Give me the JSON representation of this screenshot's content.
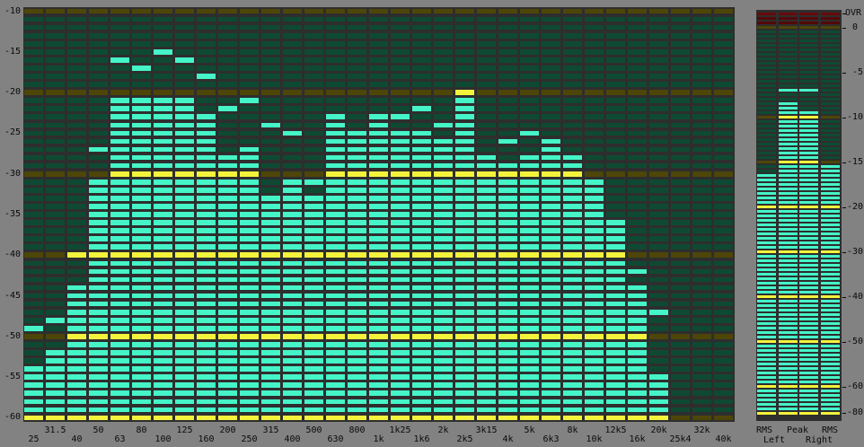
{
  "colors": {
    "lit": "#45f5c8",
    "dark": "#0e4a33",
    "marker_lit": "#f3f33c",
    "marker_dark": "#4d4608",
    "over_lit": "#6a0909",
    "panel": "#2e2e2e",
    "background": "#828282"
  },
  "rta": {
    "y_axis_labels": [
      "-10",
      "-15",
      "-20",
      "-25",
      "-30",
      "-35",
      "-40",
      "-45",
      "-50",
      "-55",
      "-60"
    ],
    "y_axis_values": [
      -10,
      -15,
      -20,
      -25,
      -30,
      -35,
      -40,
      -45,
      -50,
      -55,
      -60
    ],
    "y_range_db": [
      -60.5,
      -9.5
    ],
    "marker_levels_db": [
      -60,
      -50,
      -40,
      -30,
      -20,
      -10
    ],
    "bands": [
      {
        "label": "25",
        "level": -54,
        "peak": -49
      },
      {
        "label": "31.5",
        "level": -52,
        "peak": -48
      },
      {
        "label": "40",
        "level": -44,
        "peak": -40
      },
      {
        "label": "50",
        "level": -31,
        "peak": -27
      },
      {
        "label": "63",
        "level": -21,
        "peak": -16
      },
      {
        "label": "80",
        "level": -21,
        "peak": -17
      },
      {
        "label": "100",
        "level": -21,
        "peak": -15
      },
      {
        "label": "125",
        "level": -21,
        "peak": -16
      },
      {
        "label": "160",
        "level": -23,
        "peak": -18
      },
      {
        "label": "200",
        "level": -28,
        "peak": -22
      },
      {
        "label": "250",
        "level": -27,
        "peak": -21
      },
      {
        "label": "315",
        "level": -33,
        "peak": -24
      },
      {
        "label": "400",
        "level": -31,
        "peak": -25
      },
      {
        "label": "500",
        "level": -33,
        "peak": -31
      },
      {
        "label": "630",
        "level": -23,
        "peak": null
      },
      {
        "label": "800",
        "level": -25,
        "peak": null
      },
      {
        "label": "1k",
        "level": -23,
        "peak": null
      },
      {
        "label": "1k25",
        "level": -25,
        "peak": -23
      },
      {
        "label": "1k6",
        "level": -25,
        "peak": -22
      },
      {
        "label": "2k",
        "level": -26,
        "peak": -24
      },
      {
        "label": "2k5",
        "level": -20,
        "peak": null
      },
      {
        "label": "3k15",
        "level": -28,
        "peak": null
      },
      {
        "label": "4k",
        "level": -29,
        "peak": -26
      },
      {
        "label": "5k",
        "level": -28,
        "peak": -25
      },
      {
        "label": "6k3",
        "level": -26,
        "peak": null
      },
      {
        "label": "8k",
        "level": -28,
        "peak": null
      },
      {
        "label": "10k",
        "level": -31,
        "peak": null
      },
      {
        "label": "12k5",
        "level": -36,
        "peak": null
      },
      {
        "label": "16k",
        "level": -44,
        "peak": -42
      },
      {
        "label": "20k",
        "level": -55,
        "peak": -47
      },
      {
        "label": "25k4",
        "level": null,
        "peak": null
      },
      {
        "label": "32k",
        "level": null,
        "peak": null
      },
      {
        "label": "40k",
        "level": null,
        "peak": null
      }
    ]
  },
  "meters": {
    "scale_labels": [
      "OVR",
      "0",
      "-5",
      "-10",
      "-15",
      "-20",
      "-30",
      "-40",
      "-50",
      "-60",
      "-80"
    ],
    "scale_values_db": [
      1,
      0,
      -5,
      -10,
      -15,
      -20,
      -30,
      -40,
      -50,
      -60,
      -80
    ],
    "channels": [
      {
        "top_label": "RMS",
        "level": -16
      },
      {
        "top_label": "Peak",
        "level": -8,
        "peak": -7
      },
      {
        "top_label": "Peak",
        "level": -9,
        "peak": -7
      },
      {
        "top_label": "RMS",
        "level": -15
      }
    ],
    "bottom_labels": {
      "left": "Left",
      "right": "Right"
    }
  }
}
